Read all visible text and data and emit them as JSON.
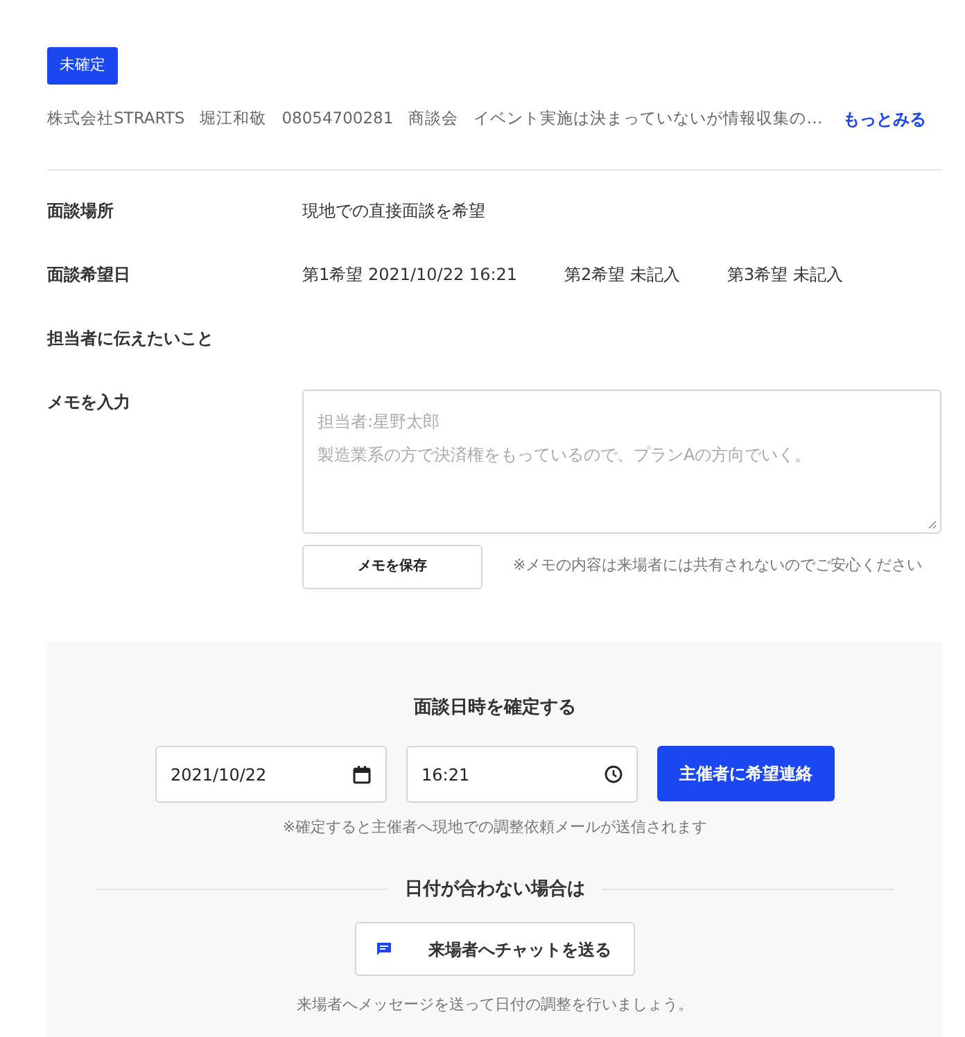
{
  "status_badge": "未確定",
  "summary": {
    "items": [
      "株式会社STRARTS",
      "堀江和敬",
      "08054700281",
      "商談会",
      "イベント実施は決まっていないが情報収集の…"
    ],
    "more_link": "もっとみる"
  },
  "details": [
    {
      "label": "面談場所",
      "values": [
        "現地での直接面談を希望"
      ]
    },
    {
      "label": "面談希望日",
      "values": [
        "第1希望 2021/10/22 16:21",
        "第2希望 未記入",
        "第3希望 未記入"
      ]
    },
    {
      "label": "担当者に伝えたいこと"
    }
  ],
  "memo": {
    "label": "メモを入力",
    "placeholder_lines": [
      "担当者:星野太郎",
      "製造業系の方で決済権をもっているので、プランAの方向でいく。"
    ],
    "save_button": "メモを保存",
    "note": "※メモの内容は来場者には共有されないのでご安心ください"
  },
  "confirm": {
    "title": "面談日時を確定する",
    "date": "2021/10/22",
    "time": "16:21",
    "submit_button": "主催者に希望連絡",
    "note": "※確定すると主催者へ現地での調整依頼メールが送信されます"
  },
  "alternative": {
    "heading": "日付が合わない場合は",
    "chat_button": "来場者へチャットを送る",
    "note": "来場者へメッセージを送って日付の調整を行いましょう。"
  }
}
